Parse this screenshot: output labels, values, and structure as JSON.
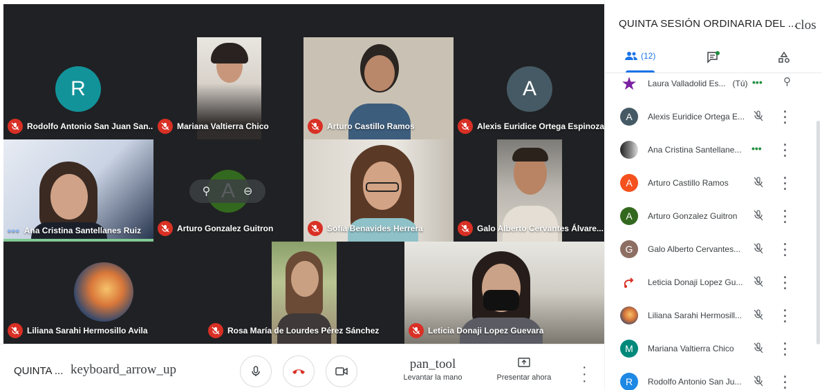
{
  "meeting": {
    "title_short": "QUINTA ...",
    "expand_icon_text": "keyboard_arrow_up"
  },
  "tiles": [
    {
      "name": "Rodolfo Antonio San Juan San...",
      "initial": "R",
      "color": "#12939a"
    },
    {
      "name": "Mariana Valtierra Chico"
    },
    {
      "name": "Arturo Castillo Ramos"
    },
    {
      "name": "Alexis Euridice Ortega Espinoza",
      "initial": "A",
      "color": "#455a64"
    },
    {
      "name": "Ana Cristina Santellanes Ruiz"
    },
    {
      "name": "Arturo Gonzalez Guitron",
      "initial": "A",
      "color": "#33691e"
    },
    {
      "name": "Sofía Benavides Herrera"
    },
    {
      "name": "Galo Alberto Cervantes Álvare..."
    },
    {
      "name": "Liliana Sarahi Hermosillo Avila"
    },
    {
      "name": "Rosa María de Lourdes Pérez Sánchez"
    },
    {
      "name": "Leticia Donaji Lopez Guevara"
    }
  ],
  "controls": {
    "raise_hand_icon_text": "pan_tool",
    "raise_hand_label": "Levantar la mano",
    "present_label": "Presentar ahora"
  },
  "panel": {
    "title": "QUINTA SESIÓN ORDINARIA DEL ...",
    "close_text": "clos",
    "people_count": "(12)",
    "participants": [
      {
        "name": "Laura Valladolid Es...",
        "suffix": "(Tú)",
        "status": "speaking"
      },
      {
        "name": "Alexis Euridice Ortega E...",
        "initial": "A",
        "color": "#455a64"
      },
      {
        "name": "Ana Cristina Santellane...",
        "status": "speaking"
      },
      {
        "name": "Arturo Castillo Ramos",
        "initial": "A",
        "color": "#f4511e"
      },
      {
        "name": "Arturo Gonzalez Guitron",
        "initial": "A",
        "color": "#33691e"
      },
      {
        "name": "Galo Alberto Cervantes...",
        "initial": "G",
        "color": "#8d6e63"
      },
      {
        "name": "Leticia Donaji Lopez Gu..."
      },
      {
        "name": "Liliana Sarahi Hermosill..."
      },
      {
        "name": "Mariana Valtierra Chico",
        "initial": "M",
        "color": "#00897b"
      },
      {
        "name": "Rodolfo Antonio San Ju...",
        "initial": "R",
        "color": "#1e88e5"
      }
    ]
  },
  "colors": {
    "mic_off": "#d93025",
    "end_call": "#d93025",
    "accent": "#1a73e8",
    "speaking": "#81c995"
  }
}
